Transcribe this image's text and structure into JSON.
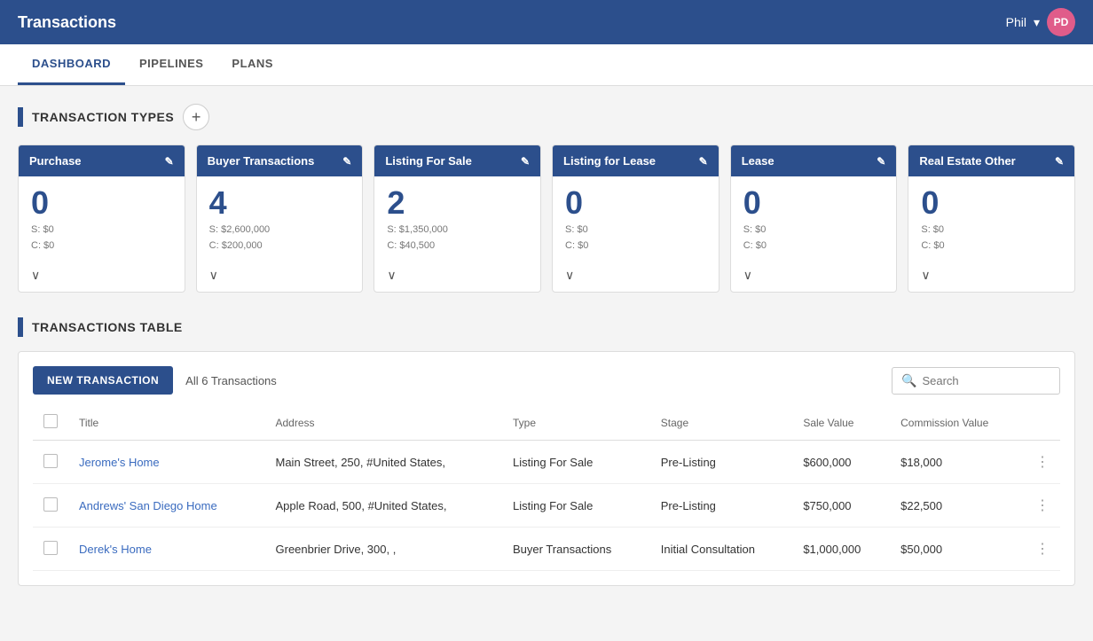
{
  "header": {
    "title": "Transactions",
    "user": "Phil",
    "user_chevron": "▾",
    "avatar_initials": "PD"
  },
  "tabs": [
    {
      "label": "DASHBOARD",
      "active": true
    },
    {
      "label": "PIPELINES",
      "active": false
    },
    {
      "label": "PLANS",
      "active": false
    }
  ],
  "transaction_types_section": {
    "title": "TRANSACTION TYPES",
    "add_label": "+"
  },
  "cards": [
    {
      "title": "Purchase",
      "count": "0",
      "sale": "S: $0",
      "commission": "C: $0"
    },
    {
      "title": "Buyer Transactions",
      "count": "4",
      "sale": "S: $2,600,000",
      "commission": "C: $200,000"
    },
    {
      "title": "Listing For Sale",
      "count": "2",
      "sale": "S: $1,350,000",
      "commission": "C: $40,500"
    },
    {
      "title": "Listing for Lease",
      "count": "0",
      "sale": "S: $0",
      "commission": "C: $0"
    },
    {
      "title": "Lease",
      "count": "0",
      "sale": "S: $0",
      "commission": "C: $0"
    },
    {
      "title": "Real Estate Other",
      "count": "0",
      "sale": "S: $0",
      "commission": "C: $0"
    }
  ],
  "transactions_table_section": {
    "title": "TRANSACTIONS TABLE",
    "new_transaction_btn": "NEW TRANSACTION",
    "all_transactions_label": "All 6 Transactions",
    "search_placeholder": "Search"
  },
  "table": {
    "columns": [
      "Title",
      "Address",
      "Type",
      "Stage",
      "Sale Value",
      "Commission Value"
    ],
    "rows": [
      {
        "title": "Jerome's Home",
        "address": "Main Street, 250, #United States,",
        "type": "Listing For Sale",
        "stage": "Pre-Listing",
        "sale_value": "$600,000",
        "commission_value": "$18,000"
      },
      {
        "title": "Andrews' San Diego Home",
        "address": "Apple Road, 500, #United States,",
        "type": "Listing For Sale",
        "stage": "Pre-Listing",
        "sale_value": "$750,000",
        "commission_value": "$22,500"
      },
      {
        "title": "Derek's Home",
        "address": "Greenbrier Drive, 300, ,",
        "type": "Buyer Transactions",
        "stage": "Initial Consultation",
        "sale_value": "$1,000,000",
        "commission_value": "$50,000"
      }
    ]
  }
}
